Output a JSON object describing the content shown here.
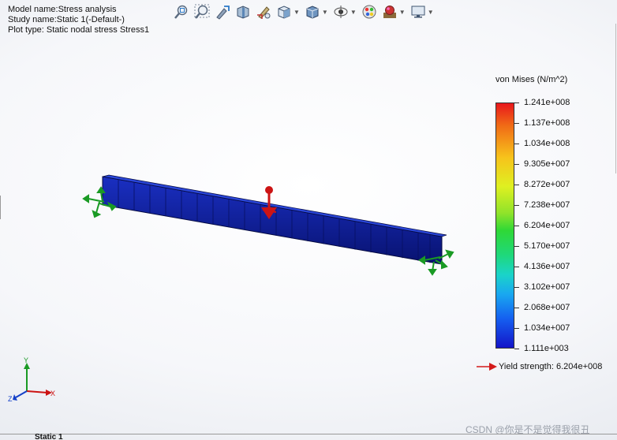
{
  "info": {
    "model_name": "Model name:Stress analysis",
    "study_name": "Study name:Static 1(-Default-)",
    "plot_type": "Plot type: Static nodal stress Stress1"
  },
  "toolbar": {
    "buttons": [
      {
        "icon": "zoom-to-fit-icon"
      },
      {
        "icon": "zoom-to-area-icon"
      },
      {
        "icon": "previous-view-icon"
      },
      {
        "icon": "section-view-icon"
      },
      {
        "icon": "dynamic-annotation-icon"
      },
      {
        "icon": "view-orientation-icon"
      },
      {
        "icon": "display-style-icon"
      },
      {
        "icon": "hide-show-items-icon"
      },
      {
        "icon": "edit-appearance-icon"
      },
      {
        "icon": "apply-scene-icon"
      },
      {
        "icon": "view-settings-icon"
      }
    ]
  },
  "legend": {
    "title": "von Mises (N/m^2)",
    "labels": [
      "1.241e+008",
      "1.137e+008",
      "1.034e+008",
      "9.305e+007",
      "8.272e+007",
      "7.238e+007",
      "6.204e+007",
      "5.170e+007",
      "4.136e+007",
      "3.102e+007",
      "2.068e+007",
      "1.034e+007",
      "1.111e+003"
    ],
    "max_color": "#e8171c",
    "min_color": "#1414c8",
    "yield_label": "Yield strength: 6.204e+008",
    "yield_color": "#d31a1a"
  },
  "triad": {
    "x": "X",
    "y": "Y",
    "z": "Z"
  },
  "colors": {
    "beam": "#0d1f9a",
    "fixture": "#1a9a24",
    "load": "#cc1414"
  },
  "tabs": {
    "bottom": "Static 1"
  },
  "watermark": "CSDN @你是不是觉得我很丑"
}
